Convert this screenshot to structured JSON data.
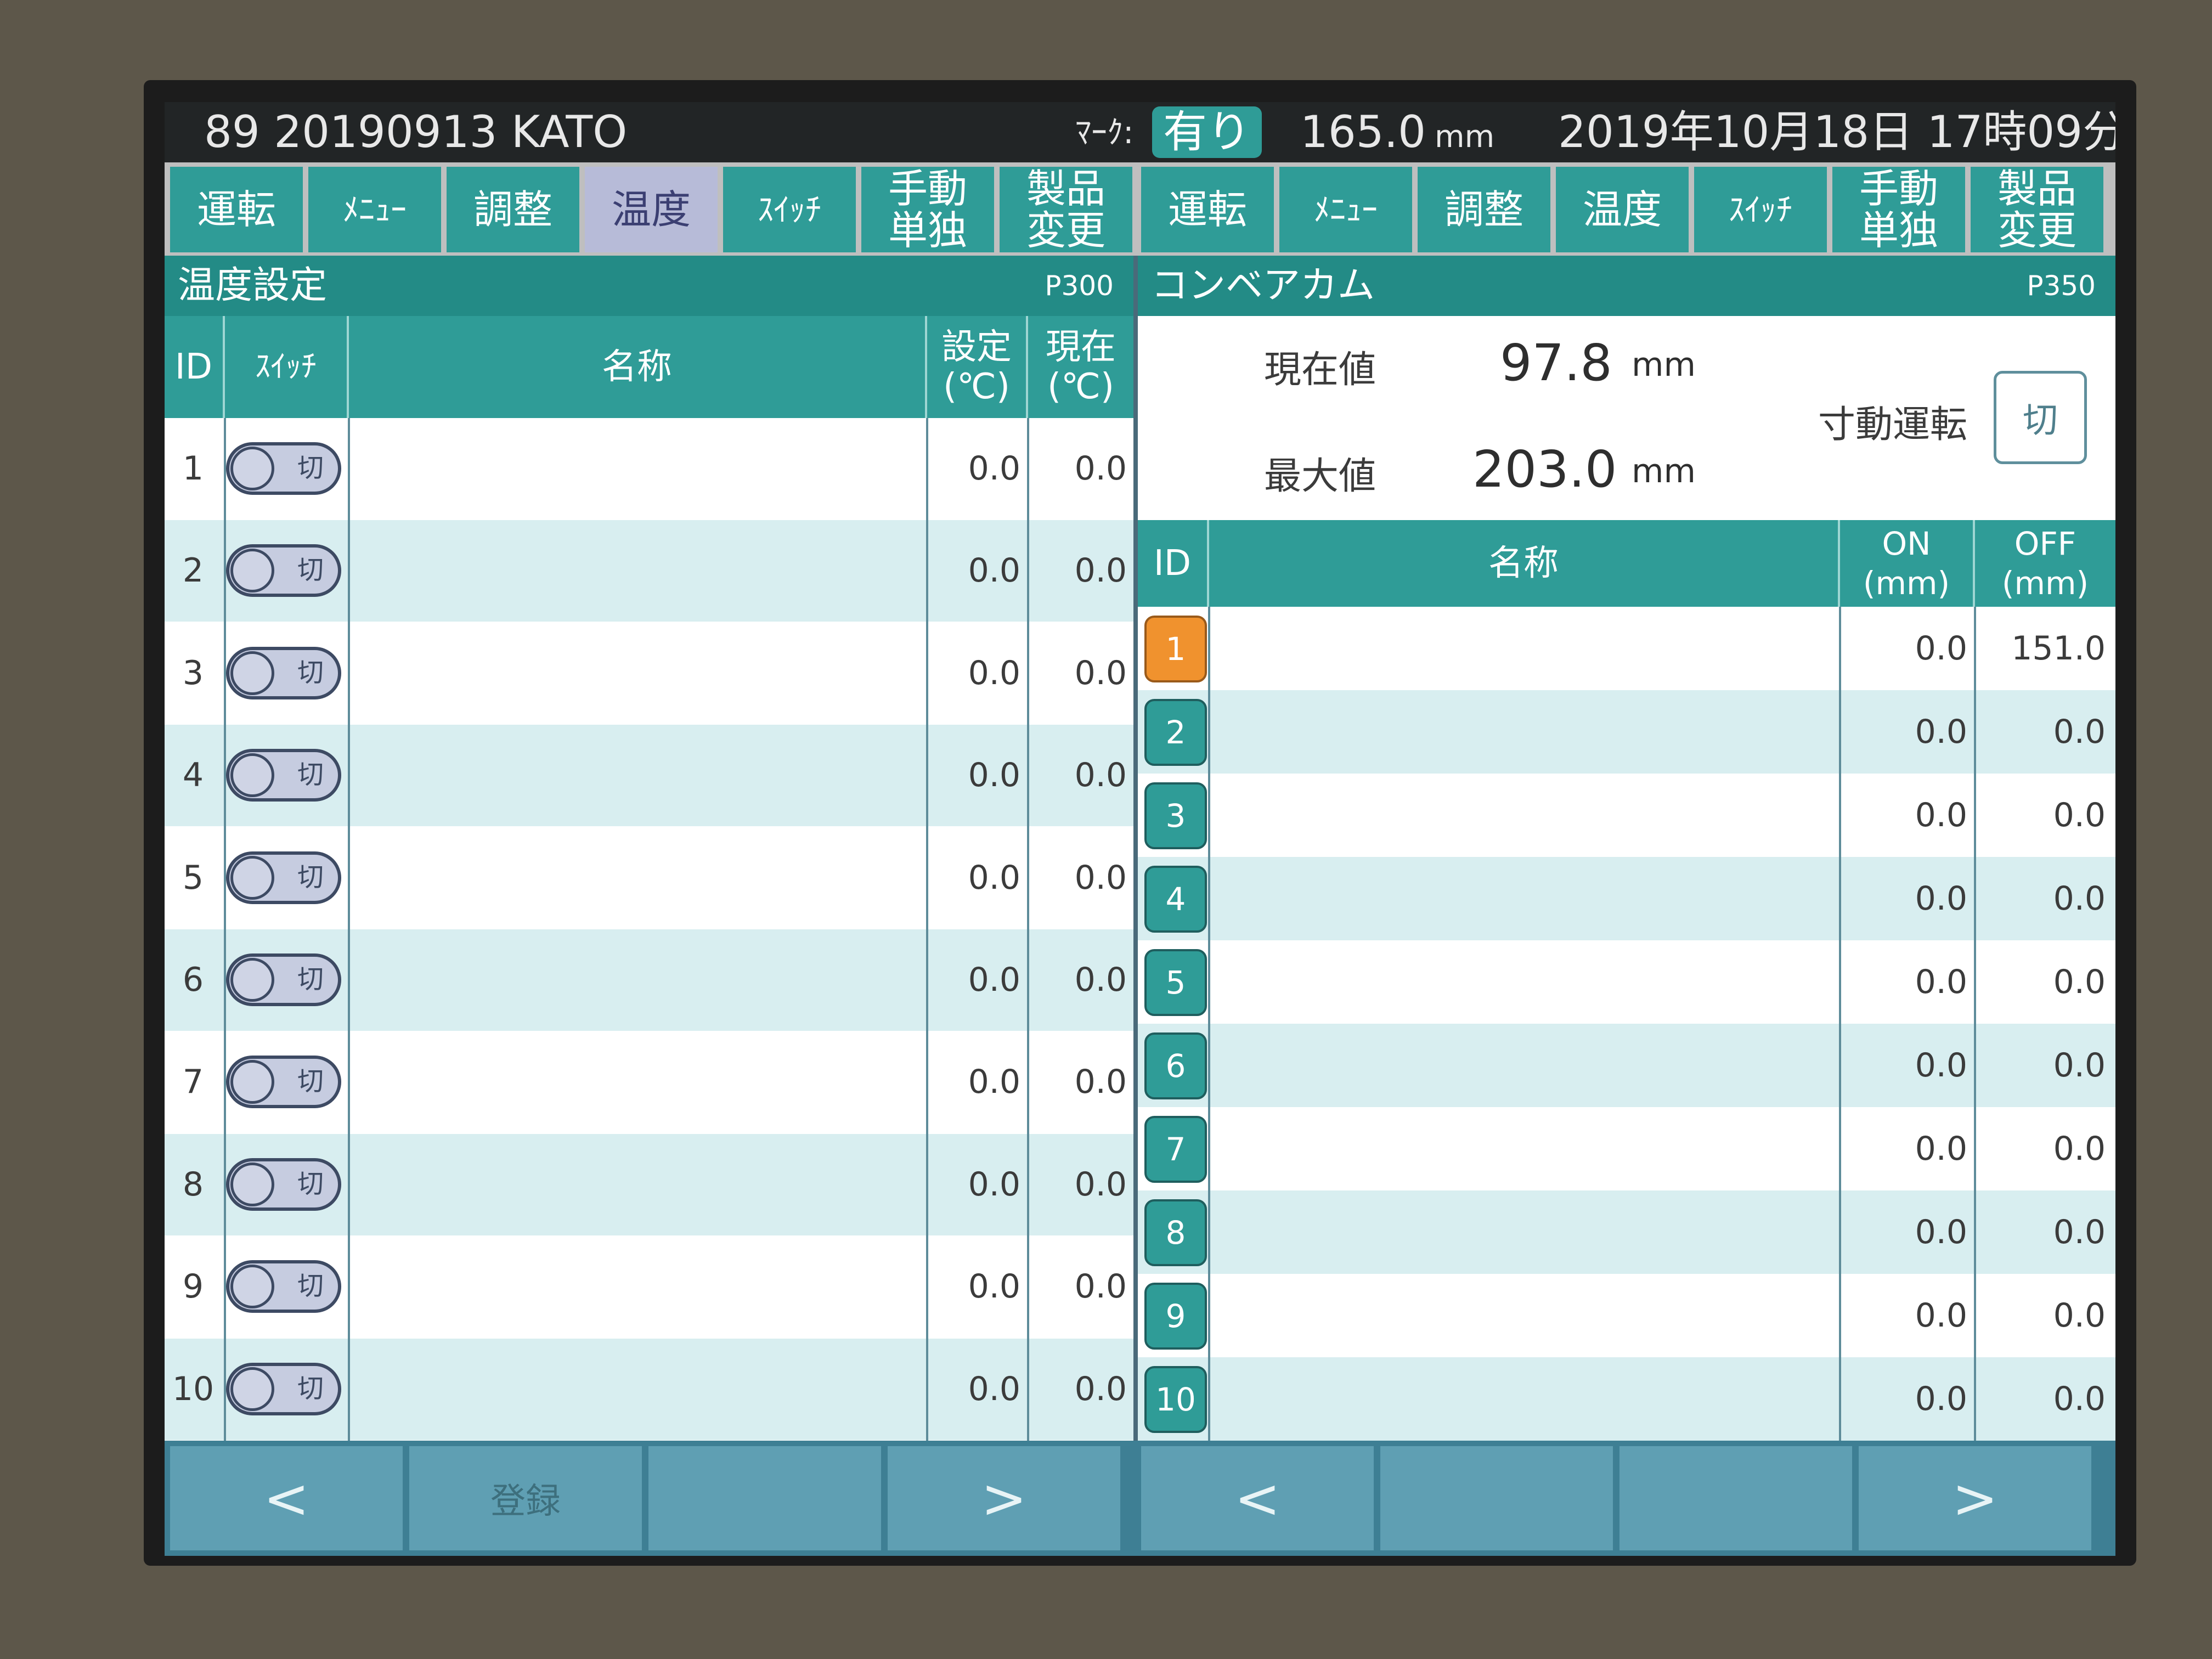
{
  "status": {
    "machine": "89  20190913 KATO",
    "mark_label": "ﾏｰｸ:",
    "mark_value": "有り",
    "thickness": "165.0",
    "thickness_unit": "mm",
    "datetime": "2019年10月18日 17時09分"
  },
  "tabs": [
    {
      "label": "運転"
    },
    {
      "label": "ﾒﾆｭｰ"
    },
    {
      "label": "調整"
    },
    {
      "label": "温度",
      "active": true
    },
    {
      "label": "ｽｲｯﾁ"
    },
    {
      "label": "手動\n単独"
    },
    {
      "label": "製品\n変更"
    },
    {
      "label": "運転"
    },
    {
      "label": "ﾒﾆｭｰ"
    },
    {
      "label": "調整"
    },
    {
      "label": "温度"
    },
    {
      "label": "ｽｲｯﾁ"
    },
    {
      "label": "手動\n単独"
    },
    {
      "label": "製品\n変更"
    }
  ],
  "left_panel": {
    "title": "温度設定",
    "code": "P300",
    "headers": {
      "id": "ID",
      "switch": "ｽｲｯﾁ",
      "name": "名称",
      "set": "設定\n(℃)",
      "current": "現在\n(℃)"
    },
    "rows": [
      {
        "id": "1",
        "switch": "切",
        "set": "0.0",
        "current": "0.0"
      },
      {
        "id": "2",
        "switch": "切",
        "set": "0.0",
        "current": "0.0"
      },
      {
        "id": "3",
        "switch": "切",
        "set": "0.0",
        "current": "0.0"
      },
      {
        "id": "4",
        "switch": "切",
        "set": "0.0",
        "current": "0.0"
      },
      {
        "id": "5",
        "switch": "切",
        "set": "0.0",
        "current": "0.0"
      },
      {
        "id": "6",
        "switch": "切",
        "set": "0.0",
        "current": "0.0"
      },
      {
        "id": "7",
        "switch": "切",
        "set": "0.0",
        "current": "0.0"
      },
      {
        "id": "8",
        "switch": "切",
        "set": "0.0",
        "current": "0.0"
      },
      {
        "id": "9",
        "switch": "切",
        "set": "0.0",
        "current": "0.0"
      },
      {
        "id": "10",
        "switch": "切",
        "set": "0.0",
        "current": "0.0"
      }
    ]
  },
  "right_panel": {
    "title": "コンベアカム",
    "code": "P350",
    "current_label": "現在値",
    "current_value": "97.8",
    "max_label": "最大値",
    "max_value": "203.0",
    "unit": "mm",
    "inching_label": "寸動運転",
    "inching_button": "切",
    "headers": {
      "id": "ID",
      "name": "名称",
      "on": "ON\n(mm)",
      "off": "OFF\n(mm)"
    },
    "rows": [
      {
        "id": "1",
        "on": "0.0",
        "off": "151.0",
        "selected": true
      },
      {
        "id": "2",
        "on": "0.0",
        "off": "0.0"
      },
      {
        "id": "3",
        "on": "0.0",
        "off": "0.0"
      },
      {
        "id": "4",
        "on": "0.0",
        "off": "0.0"
      },
      {
        "id": "5",
        "on": "0.0",
        "off": "0.0"
      },
      {
        "id": "6",
        "on": "0.0",
        "off": "0.0"
      },
      {
        "id": "7",
        "on": "0.0",
        "off": "0.0"
      },
      {
        "id": "8",
        "on": "0.0",
        "off": "0.0"
      },
      {
        "id": "9",
        "on": "0.0",
        "off": "0.0"
      },
      {
        "id": "10",
        "on": "0.0",
        "off": "0.0"
      }
    ]
  },
  "bottom": {
    "left_prev": "<",
    "register": "登録",
    "left_next": ">",
    "right_prev": "<",
    "right_next": ">"
  }
}
